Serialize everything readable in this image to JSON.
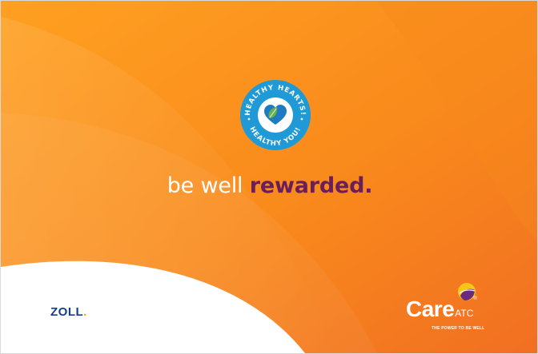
{
  "colors": {
    "orange_light": "#ff9a1e",
    "orange_dark": "#f47a1f",
    "badge_blue": "#1f9ad6",
    "heart_blue": "#1c7bc1",
    "leaf_green": "#6ab04c",
    "reward_purple": "#6a1e5a",
    "zoll_blue": "#143c8f",
    "white": "#ffffff"
  },
  "badge": {
    "top_text": "HEALTHY HEARTS!",
    "bottom_text": "HEALTHY YOU!",
    "icon": "heart-leaf-icon"
  },
  "tagline": {
    "light": "be well ",
    "bold": "rewarded."
  },
  "zoll": {
    "name": "ZOLL",
    "dot": "."
  },
  "careatc": {
    "care": "Care",
    "atc": "ATC",
    "reg": "®",
    "slogan": "THE POWER TO BE WELL"
  }
}
